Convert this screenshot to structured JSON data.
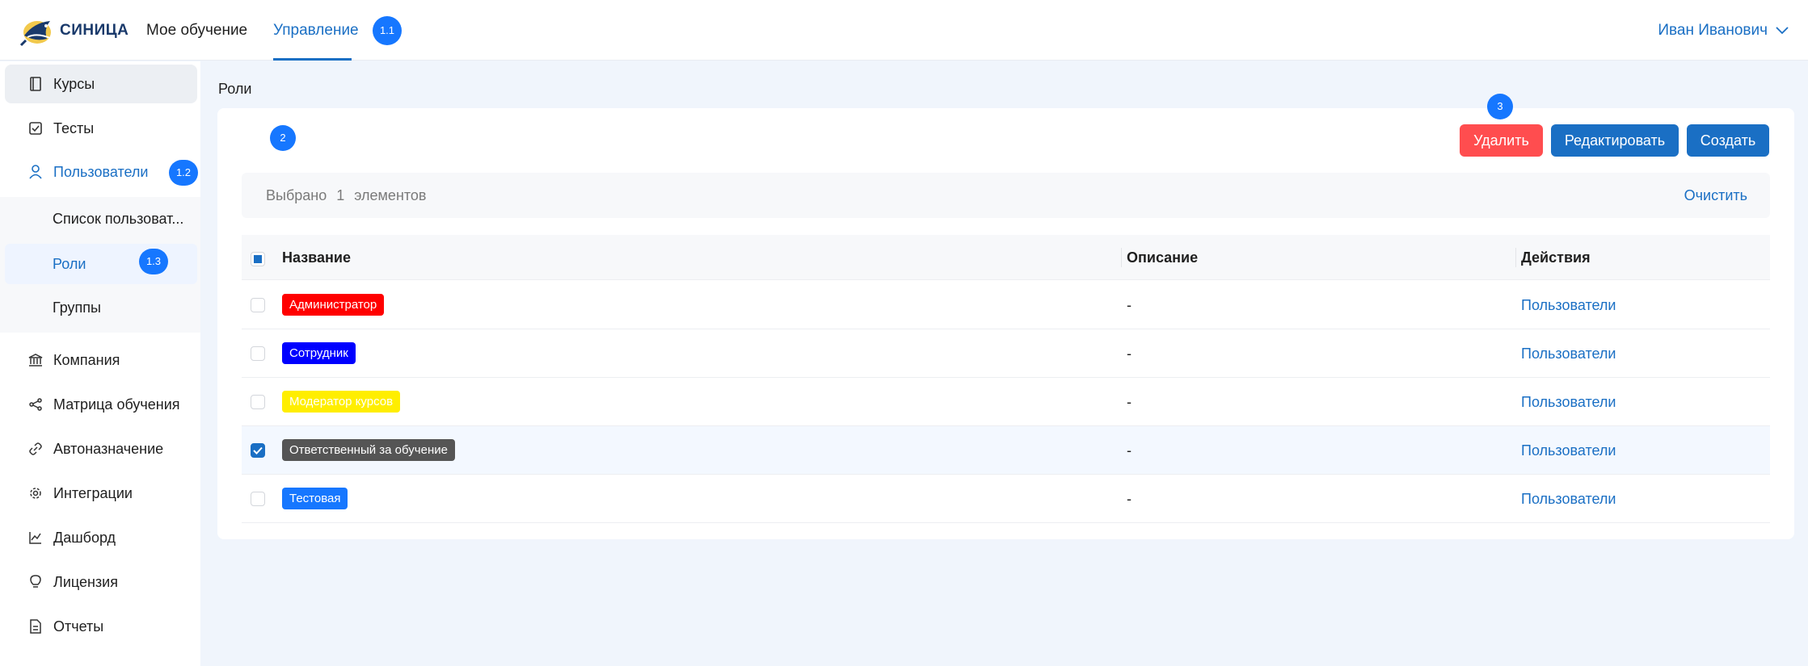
{
  "header": {
    "logo_text": "СИНИЦА",
    "nav": [
      {
        "label": "Мое обучение"
      },
      {
        "label": "Управление"
      }
    ],
    "badge_1": "1.1",
    "user_name": "Иван Иванович"
  },
  "sidebar": {
    "items": [
      {
        "label": "Курсы"
      },
      {
        "label": "Тесты"
      },
      {
        "label": "Пользователи"
      },
      {
        "label": "Компания"
      },
      {
        "label": "Матрица обучения"
      },
      {
        "label": "Автоназначение"
      },
      {
        "label": "Интеграции"
      },
      {
        "label": "Дашборд"
      },
      {
        "label": "Лицензия"
      },
      {
        "label": "Отчеты"
      }
    ],
    "users_badge": "1.2",
    "submenu": [
      {
        "label": "Список пользоват..."
      },
      {
        "label": "Роли"
      },
      {
        "label": "Группы"
      }
    ],
    "roles_badge": "1.3"
  },
  "breadcrumb": "Роли",
  "toolbar": {
    "badge_2": "2",
    "badge_3": "3",
    "delete_label": "Удалить",
    "edit_label": "Редактировать",
    "create_label": "Создать"
  },
  "selection": {
    "prefix": "Выбрано",
    "count": "1",
    "suffix": "элементов",
    "clear_label": "Очистить"
  },
  "table": {
    "columns": [
      "Название",
      "Описание",
      "Действия"
    ],
    "rows": [
      {
        "name": "Администратор",
        "color": "#ff0000",
        "description": "-",
        "action": "Пользователи",
        "checked": false
      },
      {
        "name": "Сотрудник",
        "color": "#0000ff",
        "description": "-",
        "action": "Пользователи",
        "checked": false
      },
      {
        "name": "Модератор курсов",
        "color": "#ffee00",
        "description": "-",
        "action": "Пользователи",
        "checked": false
      },
      {
        "name": "Ответственный за обучение",
        "color": "#555555",
        "description": "-",
        "action": "Пользователи",
        "checked": true
      },
      {
        "name": "Тестовая",
        "color": "#1677ff",
        "description": "-",
        "action": "Пользователи",
        "checked": false
      }
    ]
  },
  "colors": {
    "accent": "#1a6fc4",
    "danger": "#ff4d4f",
    "badge": "#1677ff"
  }
}
